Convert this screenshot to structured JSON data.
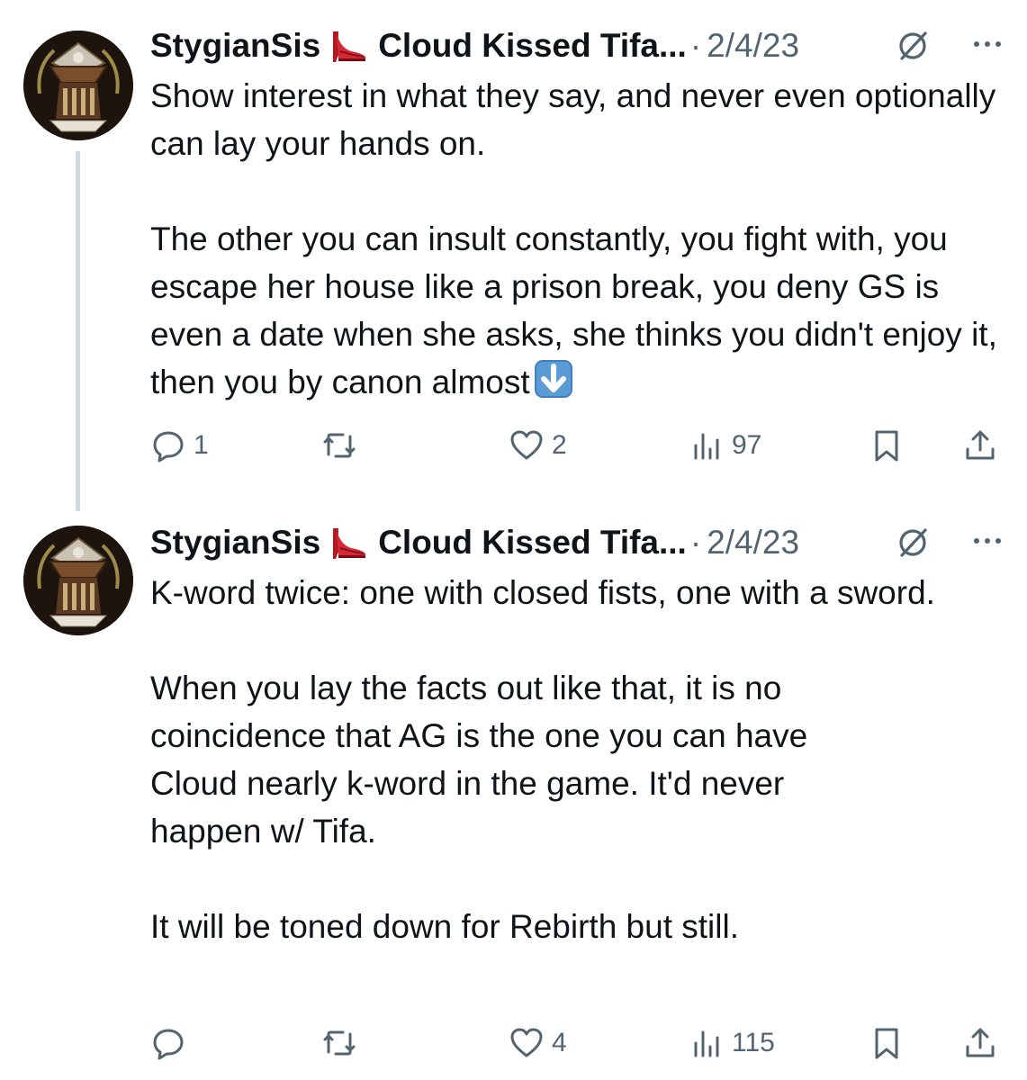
{
  "colors": {
    "text": "#0f1419",
    "secondary": "#536471",
    "thread_line": "#cfd9de",
    "heel": "#c8202c",
    "arrow_emoji_bg": "#5b9bd5"
  },
  "tweets": [
    {
      "author": "StygianSis",
      "author_emoji": "high-heel-shoe-emoji",
      "name_tail": "Cloud Kissed Tifa...",
      "separator": "·",
      "date": "2/4/23",
      "paragraphs": [
        "Show interest in what they say, and never even optionally can lay your hands on.",
        "The other you can insult constantly, you fight with, you escape her house like a prison break, you deny GS is even a date when she asks, she thinks you didn't enjoy it, then you by canon almost"
      ],
      "trailing_emoji": "down-arrow-emoji",
      "actions": {
        "replies": "1",
        "retweets": "",
        "likes": "2",
        "views": "97"
      }
    },
    {
      "author": "StygianSis",
      "author_emoji": "high-heel-shoe-emoji",
      "name_tail": "Cloud Kissed Tifa...",
      "separator": "·",
      "date": "2/4/23",
      "paragraphs": [
        "K-word twice: one with closed fists, one with a sword.",
        "When you lay the facts out like that, it is no coincidence that AG is the one you can have Cloud nearly k-word in the game. It'd never happen w/ Tifa.",
        "It will be toned down for Rebirth but still."
      ],
      "actions": {
        "replies": "",
        "retweets": "",
        "likes": "4",
        "views": "115"
      }
    }
  ]
}
